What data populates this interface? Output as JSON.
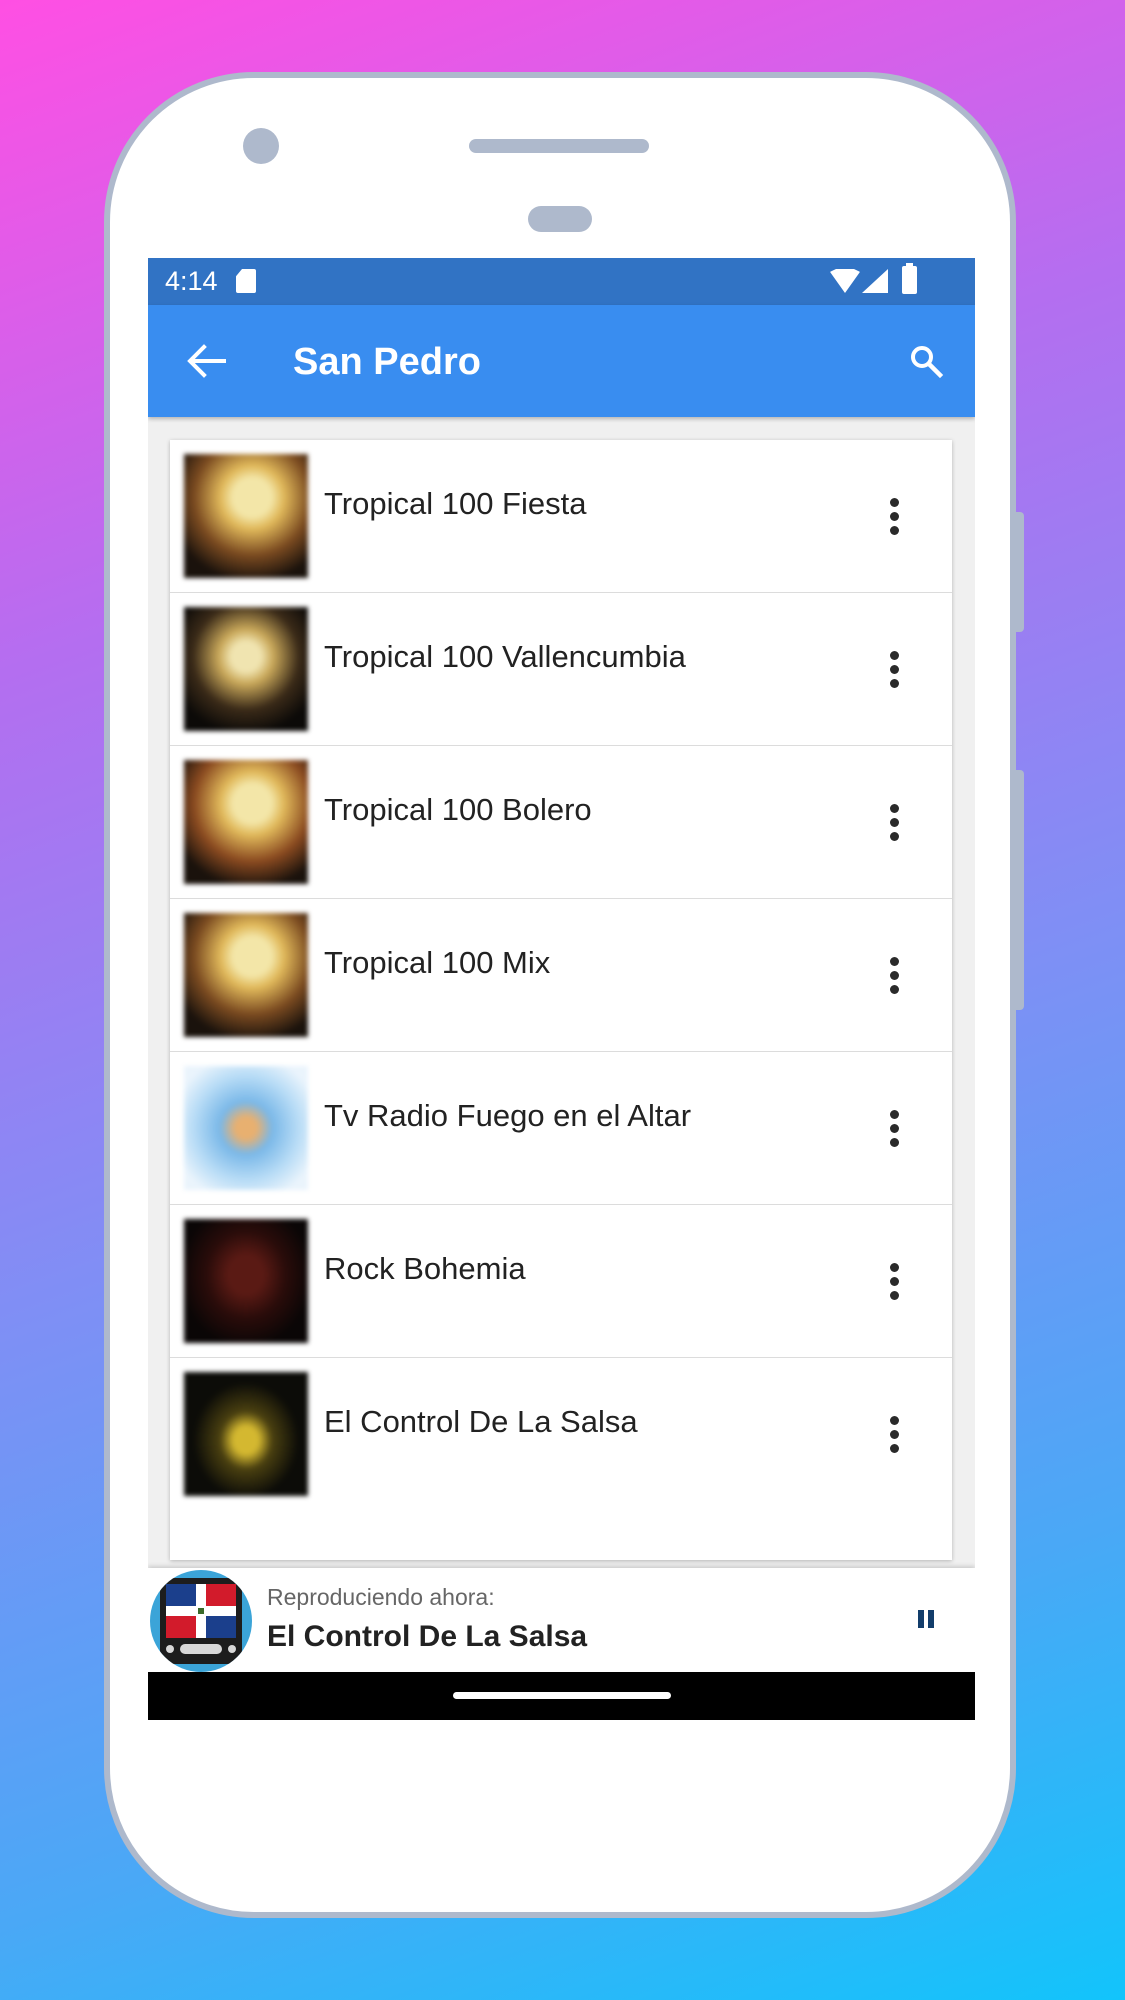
{
  "status_bar": {
    "time": "4:14"
  },
  "app_bar": {
    "title": "San Pedro"
  },
  "stations": [
    {
      "name": "Tropical 100 Fiesta"
    },
    {
      "name": "Tropical 100 Vallencumbia"
    },
    {
      "name": "Tropical 100 Bolero"
    },
    {
      "name": "Tropical 100 Mix"
    },
    {
      "name": "Tv Radio Fuego en el Altar"
    },
    {
      "name": "Rock Bohemia"
    },
    {
      "name": "El Control De La Salsa"
    }
  ],
  "player": {
    "now_playing_label": "Reproduciendo ahora:",
    "title": "El Control De La Salsa"
  },
  "colors": {
    "status_bar": "#3173c4",
    "app_bar": "#398df0",
    "pause_icon": "#123d6b"
  }
}
